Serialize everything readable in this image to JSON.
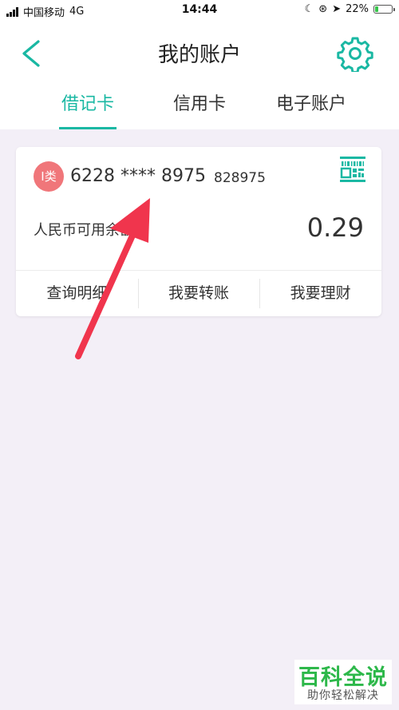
{
  "status_bar": {
    "carrier": "中国移动",
    "network": "4G",
    "time": "14:44",
    "battery_text": "22%",
    "battery_level": 0.22
  },
  "header": {
    "title": "我的账户",
    "back_icon": "chevron-left-icon",
    "settings_icon": "gear-icon"
  },
  "tabs": [
    {
      "label": "借记卡",
      "active": true
    },
    {
      "label": "信用卡",
      "active": false
    },
    {
      "label": "电子账户",
      "active": false
    }
  ],
  "card": {
    "type_badge": "I类",
    "number_masked": "6228 **** 8975",
    "number_suffix": "828975",
    "balance_label": "人民币可用余额",
    "balance_value": "0.29",
    "actions": [
      {
        "label": "查询明细"
      },
      {
        "label": "我要转账"
      },
      {
        "label": "我要理财"
      }
    ]
  },
  "watermark": {
    "main": "百科全说",
    "sub": "助你轻松解决"
  },
  "colors": {
    "accent": "#1ab8a3",
    "badge": "#f0767a",
    "arrow": "#f0354d",
    "page_bg": "#f3eff7"
  }
}
